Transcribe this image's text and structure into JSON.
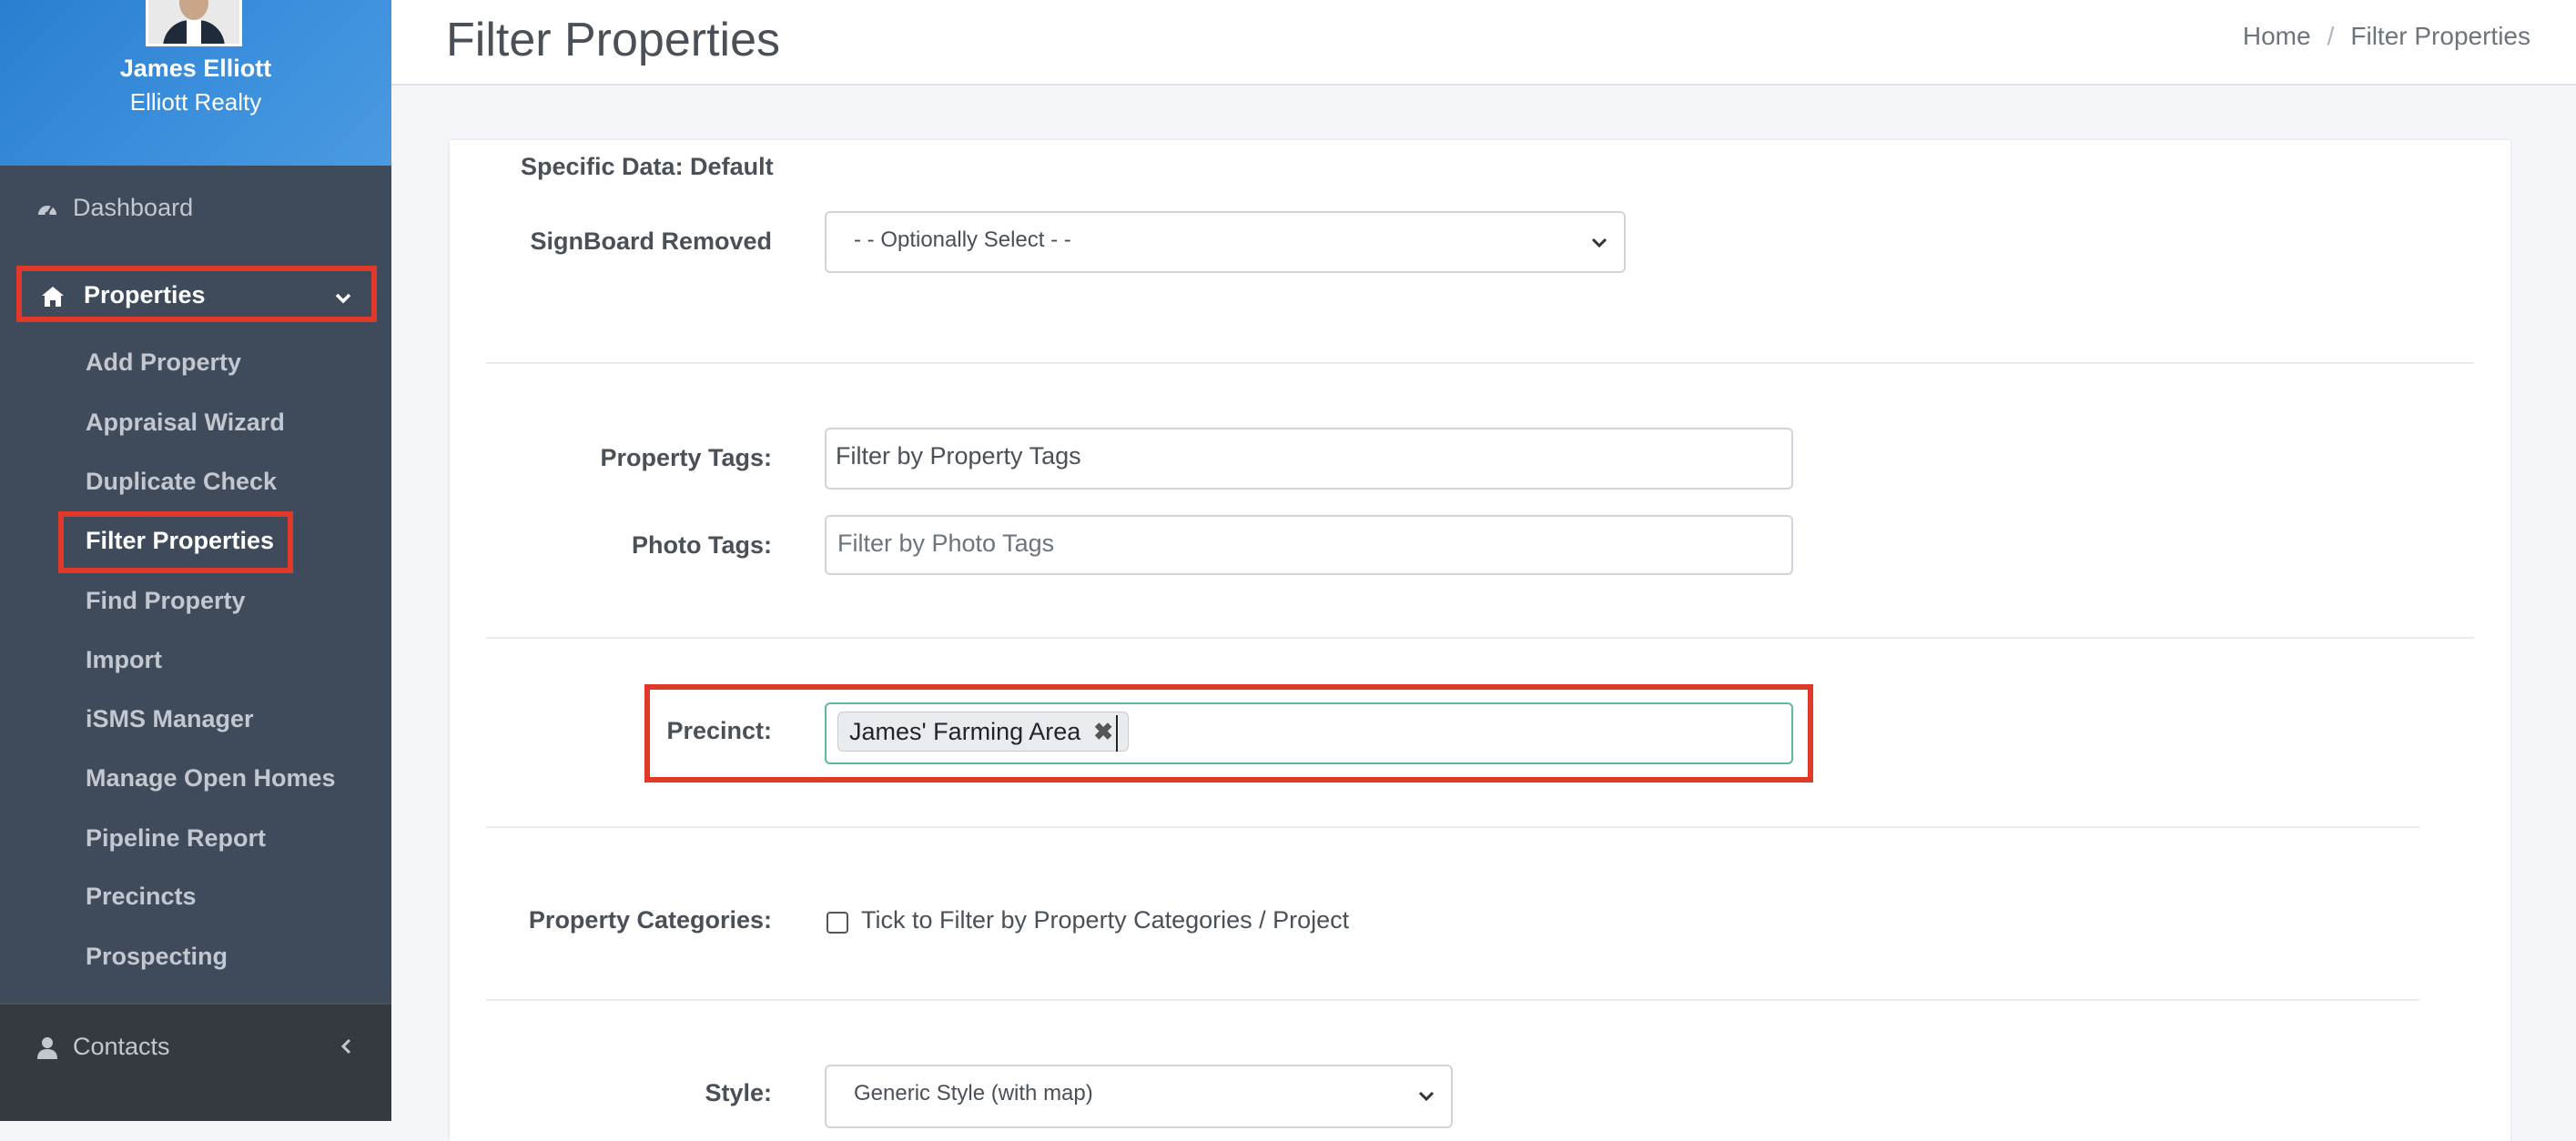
{
  "sidebar": {
    "user_name": "James Elliott",
    "company": "Elliott Realty",
    "nav": {
      "dashboard": "Dashboard",
      "properties": "Properties",
      "contacts": "Contacts"
    },
    "property_items": [
      "Add Property",
      "Appraisal Wizard",
      "Duplicate Check",
      "Filter Properties",
      "Find Property",
      "Import",
      "iSMS Manager",
      "Manage Open Homes",
      "Pipeline Report",
      "Precincts",
      "Prospecting"
    ],
    "active_item": "Filter Properties"
  },
  "header": {
    "title": "Filter Properties",
    "breadcrumb": [
      "Home",
      "Filter Properties"
    ]
  },
  "form": {
    "specific_data_label": "Specific Data: Default",
    "signboard": {
      "label": "SignBoard Removed",
      "value": "- - Optionally Select - -"
    },
    "property_tags": {
      "label": "Property Tags:",
      "value": "Filter by Property Tags"
    },
    "photo_tags": {
      "label": "Photo Tags:",
      "placeholder": "Filter by Photo Tags"
    },
    "precinct": {
      "label": "Precinct:",
      "selected": [
        "James' Farming Area"
      ]
    },
    "property_categories": {
      "label": "Property Categories:",
      "checkbox_label": "Tick to Filter by Property Categories / Project",
      "checked": false
    },
    "style": {
      "label": "Style:",
      "value": "Generic Style (with map)"
    }
  },
  "colors": {
    "sidebar_bg": "#343a40",
    "profile_bg": "#3b8fdc",
    "highlight": "#e0392a",
    "focus_border": "#5cb8a2"
  }
}
